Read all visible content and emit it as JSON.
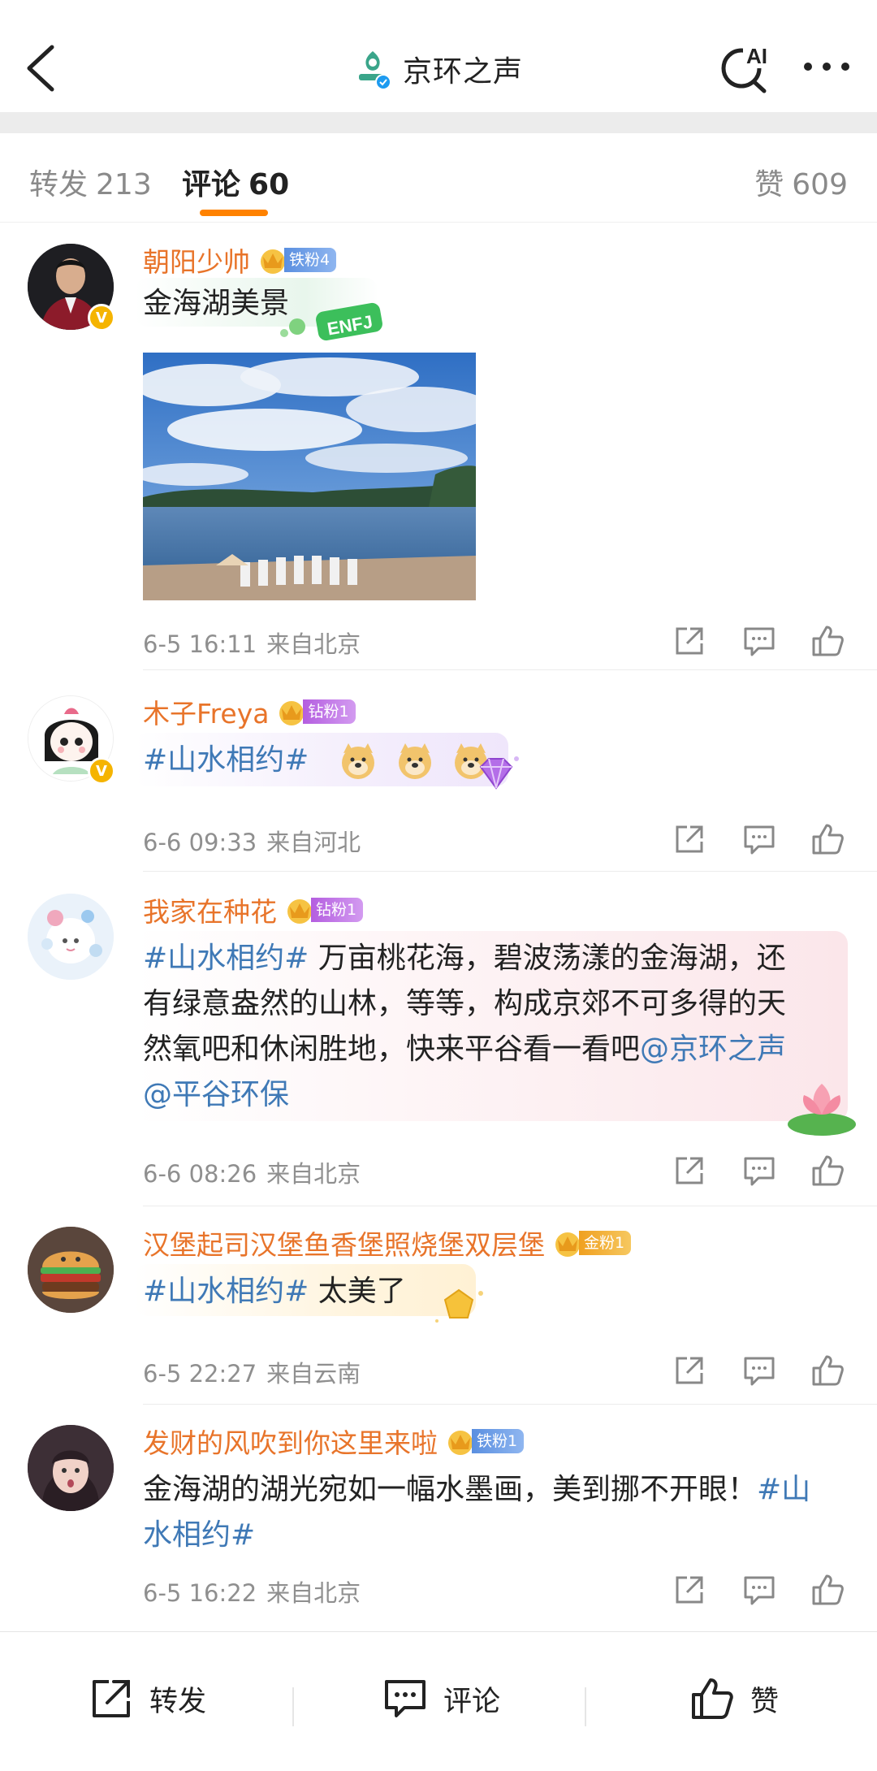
{
  "header": {
    "title": "京环之声",
    "ai_label": "AI"
  },
  "tabs": {
    "repost": {
      "label": "转发",
      "count": "213"
    },
    "comment": {
      "label": "评论",
      "count": "60"
    },
    "likes": {
      "label": "赞",
      "count": "609"
    }
  },
  "comments": [
    {
      "user": "朝阳少帅",
      "fan_badge": "铁粉4",
      "text": "金海湖美景",
      "sticker": "ENFJ",
      "time": "6-5 16:11",
      "location": "来自北京"
    },
    {
      "user": "木子Freya",
      "fan_badge": "钻粉1",
      "topic": "#山水相约#",
      "time": "6-6 09:33",
      "location": "来自河北"
    },
    {
      "user": "我家在种花",
      "fan_badge": "钻粉1",
      "topic": "#山水相约#",
      "text_line1": " 万亩桃花海，碧波荡漾的金海湖，还",
      "text_line2": "有绿意盎然的山林，等等，构成京郊不可多得的天",
      "text_line3": "然氧吧和休闲胜地，快来平谷看一看吧",
      "mention1": "@京环之声",
      "mention2": "@平谷环保",
      "time": "6-6 08:26",
      "location": "来自北京"
    },
    {
      "user": "汉堡起司汉堡鱼香堡照烧堡双层堡",
      "fan_badge": "金粉1",
      "topic": "#山水相约#",
      "text": " 太美了",
      "time": "6-5 22:27",
      "location": "来自云南"
    },
    {
      "user": "发财的风吹到你这里来啦",
      "fan_badge": "铁粉1",
      "text": "金海湖的湖光宛如一幅水墨画，美到挪不开眼！",
      "topic_part1": "#山",
      "topic_part2": "水相约#",
      "time": "6-5 16:22",
      "location": "来自北京"
    }
  ],
  "bottom_bar": {
    "repost": "转发",
    "comment": "评论",
    "like": "赞"
  },
  "colors": {
    "username": "#e8742a",
    "link": "#3f79b6",
    "tab_indicator": "#ff8200",
    "meta": "#8f8f8f"
  }
}
